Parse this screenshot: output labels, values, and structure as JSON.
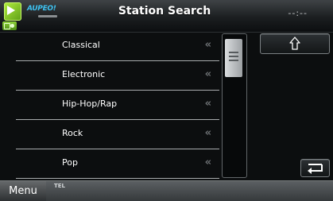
{
  "header": {
    "brand": "AUPEO!",
    "title": "Station Search",
    "clock": "--:--"
  },
  "stations": [
    {
      "label": "Classical"
    },
    {
      "label": "Electronic"
    },
    {
      "label": "Hip-Hop/Rap"
    },
    {
      "label": "Rock"
    },
    {
      "label": "Pop"
    }
  ],
  "chevron": "«",
  "scroll": {
    "position": 0
  },
  "footer": {
    "menu_label": "Menu",
    "tel_label": "TEL"
  },
  "icons": {
    "source": "play-source-icon",
    "up": "up-arrow-icon",
    "back": "return-icon",
    "grip": "scroll-grip-icon"
  },
  "colors": {
    "accent_green": "#7cc52a",
    "brand_blue": "#3ec2f1",
    "background": "#0c0e0f"
  }
}
